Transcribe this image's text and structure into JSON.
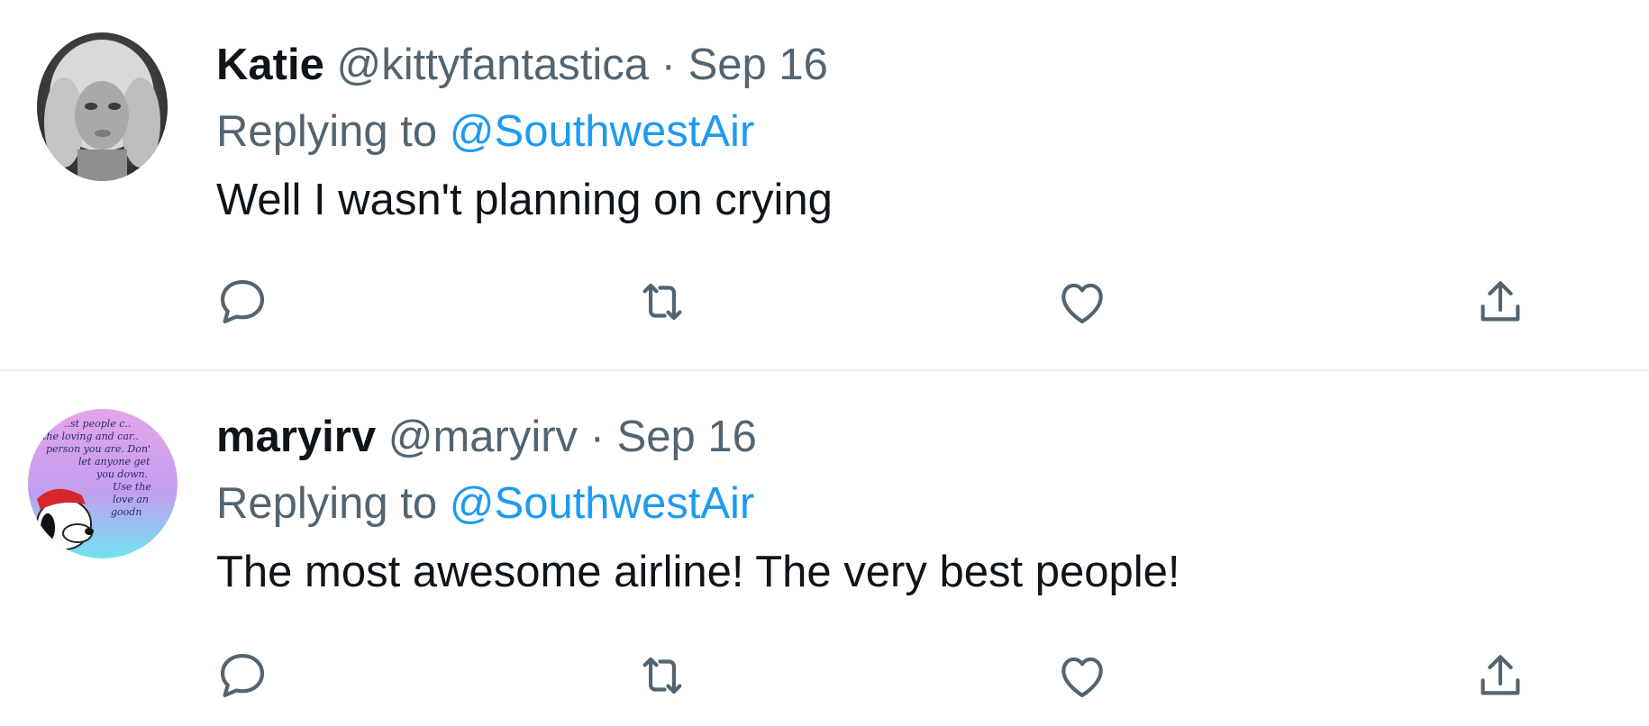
{
  "tweets": [
    {
      "name": "Katie",
      "handle": "@kittyfantastica",
      "separator": "·",
      "date": "Sep 16",
      "replying_prefix": "Replying to ",
      "replying_to": "@SouthwestAir",
      "text": "Well I wasn't planning on crying",
      "avatar": "profile-photo-grayscale-woman"
    },
    {
      "name": "maryirv",
      "handle": "@maryirv",
      "separator": "·",
      "date": "Sep 16",
      "replying_prefix": "Replying to ",
      "replying_to": "@SouthwestAir",
      "text": "The most awesome airline! The very best people!",
      "avatar": "snoopy-quote-avatar"
    }
  ],
  "actions": [
    "reply-icon",
    "retweet-icon",
    "like-icon",
    "share-icon"
  ],
  "colors": {
    "text": "#0f1419",
    "secondary": "#536471",
    "link": "#1d9bf0",
    "divider": "#e8ecef"
  }
}
